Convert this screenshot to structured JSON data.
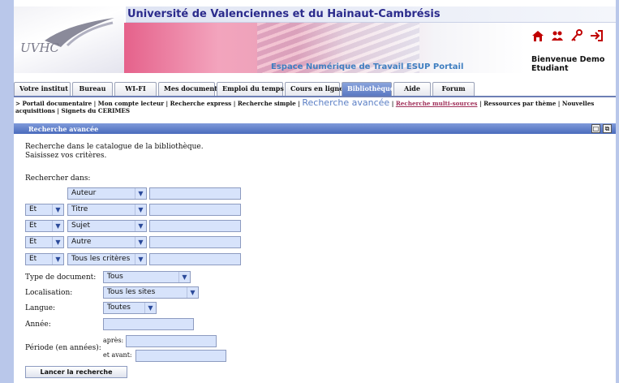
{
  "header": {
    "university_title": "Université de Valenciennes et du Hainaut-Cambrésis",
    "logo_text": "UVHC",
    "portal_title": "Espace Numérique de Travail ESUP Portail",
    "welcome_line1": "Bienvenue Demo",
    "welcome_line2": "Etudiant",
    "icons": [
      "home-icon",
      "group-icon",
      "key-icon",
      "logout-icon"
    ],
    "accent_color": "#c00000"
  },
  "tabs": [
    {
      "label": "Votre institut"
    },
    {
      "label": "Bureau"
    },
    {
      "label": "WI-FI"
    },
    {
      "label": "Mes documents"
    },
    {
      "label": "Emploi du temps"
    },
    {
      "label": "Cours en ligne"
    },
    {
      "label": "Bibliothèque",
      "active": true
    },
    {
      "label": "Aide"
    },
    {
      "label": "Forum"
    }
  ],
  "subnav": {
    "prefix": "> ",
    "portail": "Portail documentaire",
    "compte": "Mon compte lecteur",
    "express": "Recherche express",
    "simple": "Recherche simple",
    "avancee": "Recherche avancée",
    "multi": "Recherche multi-sources",
    "ressources": "Ressources par thème",
    "nouvelles": "Nouvelles acquisitions",
    "signets": "Signets du CERIMES",
    "separator": " | "
  },
  "panel": {
    "title": "Recherche avancée",
    "minimize_label": "□",
    "maximize_label": "⧉"
  },
  "intro": {
    "line1": "Recherche dans le catalogue de la bibliothèque.",
    "line2": "Saisissez vos critères."
  },
  "form": {
    "search_in_label": "Rechercher dans:",
    "rows": [
      {
        "operator": "",
        "field": "Auteur"
      },
      {
        "operator": "Et",
        "field": "Titre"
      },
      {
        "operator": "Et",
        "field": "Sujet"
      },
      {
        "operator": "Et",
        "field": "Autre"
      },
      {
        "operator": "Et",
        "field": "Tous les critères"
      }
    ],
    "doc_type_label": "Type de document:",
    "doc_type_value": "Tous",
    "location_label": "Localisation:",
    "location_value": "Tous les sites",
    "language_label": "Langue:",
    "language_value": "Toutes",
    "year_label": "Année:",
    "period_label": "Période (en années):",
    "after_label": "après:",
    "before_label": "et avant:",
    "submit_label": "Lancer la recherche"
  }
}
